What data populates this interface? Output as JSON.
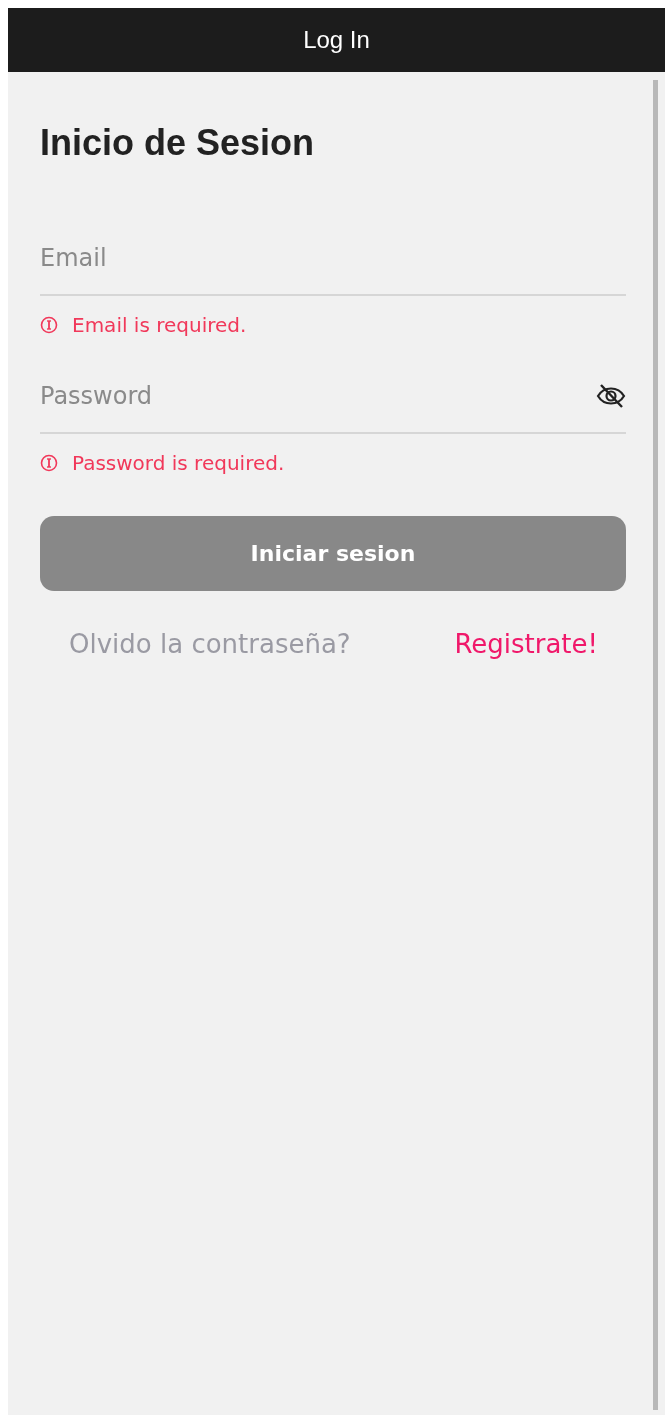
{
  "header": {
    "title": "Log In"
  },
  "heading": "Inicio de Sesion",
  "fields": [
    {
      "kind": "email",
      "placeholder": "Email",
      "error": "Email is required."
    },
    {
      "kind": "password",
      "placeholder": "Password",
      "error": "Password is required.",
      "hidden": true
    }
  ],
  "submit": {
    "label": "Iniciar sesion",
    "disabled": true
  },
  "links": [
    {
      "kind": "secondary",
      "label": "Olvido la contraseña?"
    },
    {
      "kind": "primary",
      "label": "Registrate!"
    }
  ]
}
